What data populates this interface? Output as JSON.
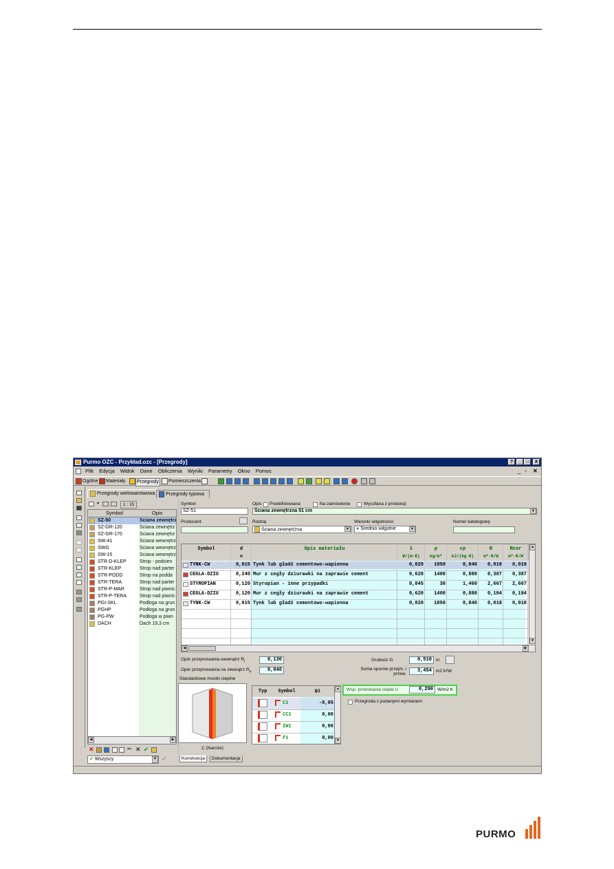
{
  "window": {
    "title": "Purmo OZC - Przykład.ozc - [Przegrody]",
    "buttons": [
      "?",
      "_",
      "□",
      "X"
    ]
  },
  "menu": [
    "Plik",
    "Edycja",
    "Widok",
    "Dane",
    "Obliczenia",
    "Wyniki",
    "Parametry",
    "Okno",
    "Pomoc"
  ],
  "toolbar": {
    "ogolne": "Ogólne",
    "materialy": "Materiały",
    "przegrody": "Przegrody",
    "pomieszczenia": "Pomieszczenia"
  },
  "tabs": {
    "wielowarstwowa": "Przegrody wielowarstwowa",
    "typowa": "Przegrody typowa"
  },
  "list": {
    "scale": "1 : 15",
    "headers": [
      "Symbol",
      "Opis"
    ],
    "rows": [
      {
        "symbol": "SZ-50",
        "opis": "Ściana zewnętrz",
        "icon": "wall-ext-icon"
      },
      {
        "symbol": "SZ-GR-120",
        "opis": "Ściana zewnętrz",
        "icon": "wall-ground-icon"
      },
      {
        "symbol": "SZ-GR-170",
        "opis": "Ściana zewnętrz",
        "icon": "wall-ground-icon"
      },
      {
        "symbol": "SW-41",
        "opis": "Ściana wewnętrz",
        "icon": "wall-int-icon"
      },
      {
        "symbol": "SWG",
        "opis": "Ściana wewnętrz",
        "icon": "wall-int-icon"
      },
      {
        "symbol": "SW-15",
        "opis": "Ściana wewnętrz",
        "icon": "wall-int-icon"
      },
      {
        "symbol": "STR-D-KLEP",
        "opis": "Strop - podcien",
        "icon": "ceiling-icon"
      },
      {
        "symbol": "STR-KLEP",
        "opis": "Strop nad parter",
        "icon": "ceiling-icon"
      },
      {
        "symbol": "STR-PODD",
        "opis": "Strop na podda",
        "icon": "ceiling-icon"
      },
      {
        "symbol": "STR-TERA",
        "opis": "Strop nad parter",
        "icon": "ceiling-icon"
      },
      {
        "symbol": "STR-P-MAR",
        "opis": "Strop nad piwnic",
        "icon": "ceiling-icon"
      },
      {
        "symbol": "STR-P-TERA",
        "opis": "Strop nad piwnic",
        "icon": "ceiling-icon"
      },
      {
        "symbol": "PGI-SKL",
        "opis": "Podłoga na grun",
        "icon": "floor-icon"
      },
      {
        "symbol": "PGHP",
        "opis": "Podłoga na grun",
        "icon": "floor-icon"
      },
      {
        "symbol": "PG-PW",
        "opis": "Podłoga w piwn",
        "icon": "floor-icon"
      },
      {
        "symbol": "DACH",
        "opis": "Dach 19,3 cm",
        "icon": "roof-icon"
      }
    ],
    "filter": "Wszyscy"
  },
  "form": {
    "symbol_label": "Symbol",
    "symbol_value": "SZ-51",
    "opis_label": "Opis",
    "predef_label": "Predefiniowana",
    "zamow_label": "Na zamówienie",
    "wycof_label": "Wycofana z produkcji",
    "opis_value": "Ściana zewnętrzna 51 cm",
    "producent_label": "Producent",
    "rodzaj_label": "Rodzaj",
    "rodzaj_value": "Ściana zewnętrzna",
    "warunki_label": "Warunki wilgotności",
    "warunki_value": "Średnio wilgotne",
    "katalog_label": "Numer katalogowy"
  },
  "layers": {
    "headers": [
      "Symbol",
      "d",
      "Opis materiału",
      "λ",
      "ρ",
      "cp",
      "R",
      "Rcor"
    ],
    "units": [
      "",
      "m",
      "",
      "W/(m·K)",
      "kg/m³",
      "kJ/(kg·K)",
      "m²·K/W",
      "m²·K/W"
    ],
    "rows": [
      {
        "symbol": "TYNK-CW",
        "d": "0,015",
        "opis": "Tynk lub gładź cementowo-wapienna",
        "lambda": "0,820",
        "rho": "1850",
        "cp": "0,840",
        "r": "0,018",
        "rcor": "0,018",
        "icon": "plaster-icon"
      },
      {
        "symbol": "CEGLA-DZIU",
        "d": "0,240",
        "opis": "Mur z cegły dziurawki na zaprawie cement",
        "lambda": "0,620",
        "rho": "1400",
        "cp": "0,880",
        "r": "0,387",
        "rcor": "0,387",
        "icon": "brick-icon"
      },
      {
        "symbol": "STYROPIAN",
        "d": "0,120",
        "opis": "Styropian - inne przypadki",
        "lambda": "0,045",
        "rho": "30",
        "cp": "1,460",
        "r": "2,667",
        "rcor": "2,667",
        "icon": "styrofoam-icon"
      },
      {
        "symbol": "CEGLA-DZIU",
        "d": "0,120",
        "opis": "Mur z cegły dziurawki na zaprawie cement",
        "lambda": "0,620",
        "rho": "1400",
        "cp": "0,880",
        "r": "0,194",
        "rcor": "0,194",
        "icon": "brick-icon"
      },
      {
        "symbol": "TYNK-CW",
        "d": "0,015",
        "opis": "Tynk lub gładź cementowo-wapienna",
        "lambda": "0,820",
        "rho": "1850",
        "cp": "0,840",
        "r": "0,018",
        "rcor": "0,018",
        "icon": "plaster-icon"
      }
    ]
  },
  "resist": {
    "rsi_label": "Opór przejmowania wewnątrz R",
    "rsi_sub": "i",
    "rsi_value": "0,130",
    "rse_label": "Opór przejmowania na zewnątrz R",
    "rse_sub": "e",
    "rse_value": "0,040",
    "grubosc_label": "Grubość G",
    "grubosc_value": "0,510",
    "grubosc_unit": "m",
    "suma_label": "Suma oporów przejm. i przew.",
    "suma_value": "3,454",
    "suma_unit": "m2 K/W",
    "u_label": "Wsp. przenikania ciepła U",
    "u_value": "0,290",
    "u_unit": "W/m2 K",
    "wymiary_label": "Przegroda z podanymi wymiarami"
  },
  "bridges": {
    "title": "Standardowe mostki cieplne",
    "caption": "C (Naroże)",
    "headers": [
      "Typ",
      "Symbol",
      "ψi"
    ],
    "rows": [
      {
        "symbol": "C1",
        "psi": "-0,05"
      },
      {
        "symbol": "CC1",
        "psi": "0,00"
      },
      {
        "symbol": "IW1",
        "psi": "0,00"
      },
      {
        "symbol": "F1",
        "psi": "0,00"
      }
    ]
  },
  "bottom_tabs": [
    "Konstrukcja",
    "Dokumentacja"
  ],
  "brand": "PURMO",
  "colors": {
    "title_bar": "#0a246a",
    "green_text": "#006000",
    "cyan_cell": "#d8fbfb",
    "u_frame": "#4cd04c",
    "logo": "#e8641e"
  }
}
